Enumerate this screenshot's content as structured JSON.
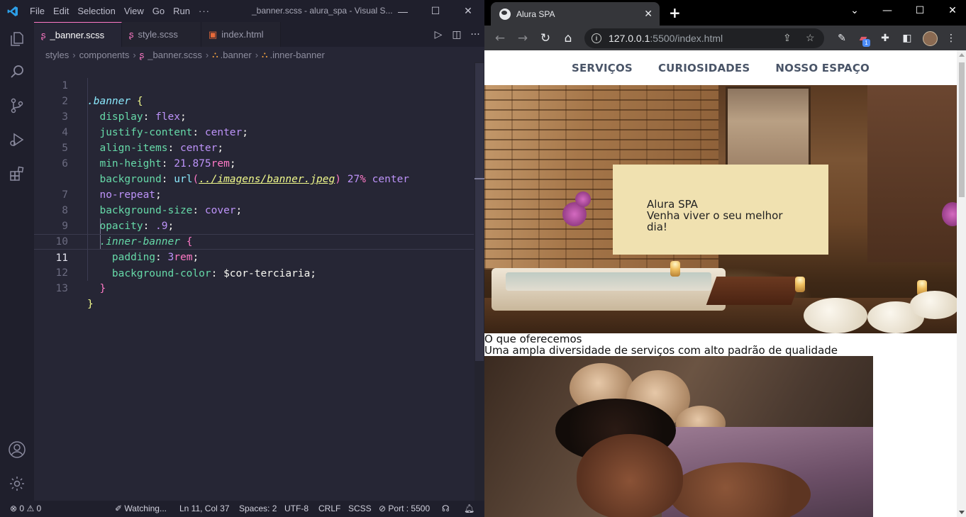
{
  "vscode": {
    "menu": [
      "File",
      "Edit",
      "Selection",
      "View",
      "Go",
      "Run"
    ],
    "menu_more": "···",
    "window_title": "_banner.scss - alura_spa - Visual S...",
    "tabs": [
      {
        "label": "_banner.scss",
        "icon": "sass-icon",
        "active": true
      },
      {
        "label": "style.scss",
        "icon": "sass-icon",
        "active": false
      },
      {
        "label": "index.html",
        "icon": "html5-icon",
        "active": false
      }
    ],
    "breadcrumb": [
      "styles",
      "components",
      "_banner.scss",
      ".banner",
      ".inner-banner"
    ],
    "line_numbers": [
      "1",
      "2",
      "3",
      "4",
      "5",
      "6",
      "",
      "7",
      "8",
      "9",
      "10",
      "11",
      "12",
      "13"
    ],
    "status": {
      "errors": "0",
      "warnings": "0",
      "watching": "Watching...",
      "position": "Ln 11, Col 37",
      "spaces": "Spaces: 2",
      "encoding": "UTF-8",
      "eol": "CRLF",
      "language": "SCSS",
      "port": "Port : 5500"
    }
  },
  "code": {
    "l1_sel": ".banner",
    "l1_brace": "{",
    "l2_prop": "display",
    "l2_val": "flex",
    "l3_prop": "justify-content",
    "l3_val": "center",
    "l4_prop": "align-items",
    "l4_val": "center",
    "l5_prop": "min-height",
    "l5_num": "21.875",
    "l5_unit": "rem",
    "l6_prop": "background",
    "l6_fn": "url",
    "l6_str": "../imagens/banner.jpeg",
    "l6_num": "27",
    "l6_unit": "%",
    "l6_val": "center",
    "l6b_val": "no-repeat",
    "l7_prop": "background-size",
    "l7_val": "cover",
    "l8_prop": "opacity",
    "l8_num": ".9",
    "l9_sel": ".inner-banner",
    "l9_brace": "{",
    "l10_prop": "padding",
    "l10_num": "3",
    "l10_unit": "rem",
    "l11_prop": "background-color",
    "l11_var": "$cor-terciaria",
    "l12_brace": "}",
    "l13_brace": "}",
    "colon": ":",
    "semicolon": ";",
    "paren_open": "(",
    "paren_close": ")"
  },
  "chrome": {
    "tab_title": "Alura SPA",
    "url_host": "127.0.0.1",
    "url_rest": ":5500/index.html",
    "extension_badge": "1"
  },
  "site": {
    "nav": [
      "SERVIÇOS",
      "CURIOSIDADES",
      "NOSSO ESPAÇO"
    ],
    "banner_title": "Alura SPA",
    "banner_subtitle": "Venha viver o seu melhor dia!",
    "section_title": "O que oferecemos",
    "section_subtitle": "Uma ampla diversidade de serviços com alto padrão de qualidade"
  },
  "colors": {
    "inner_banner_bg": "#f0e1b0",
    "vscode_bg": "#262635",
    "chrome_toolbar": "#35363a"
  }
}
